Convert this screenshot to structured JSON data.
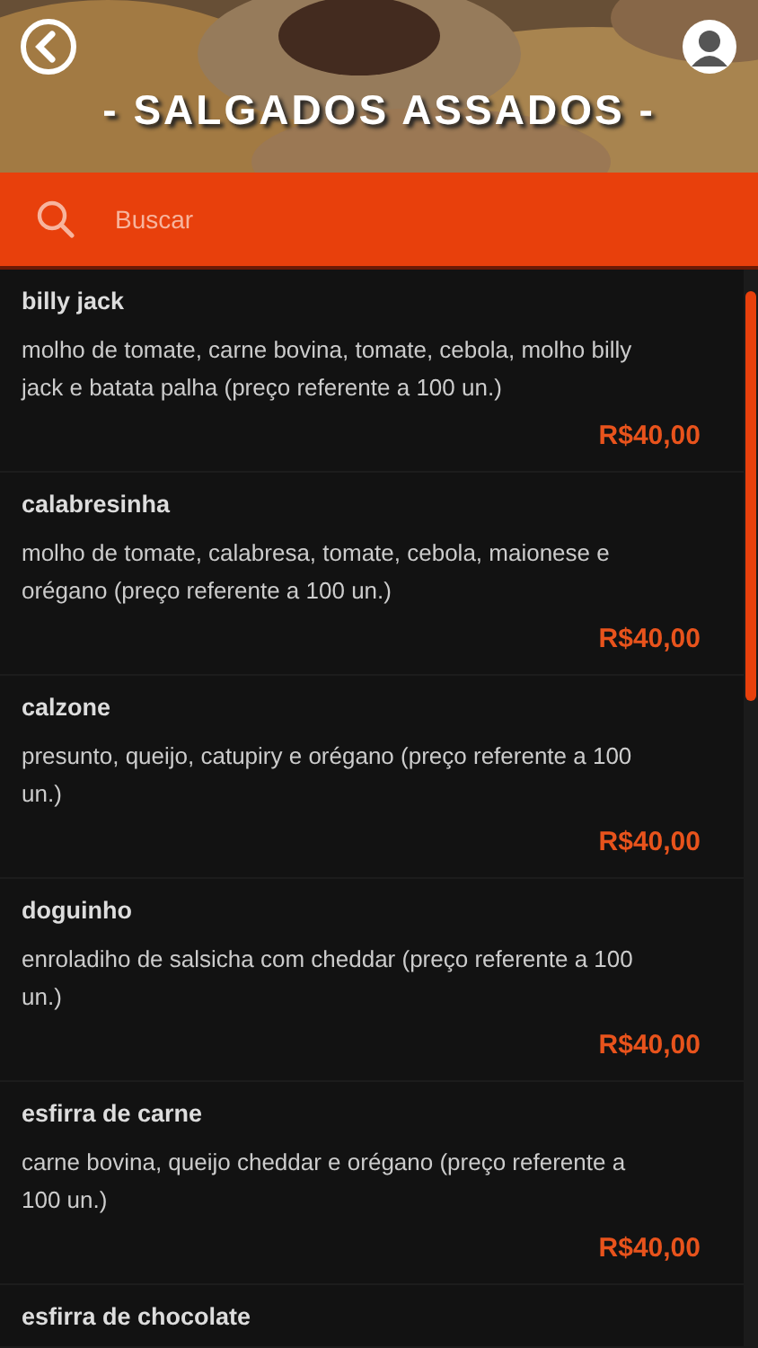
{
  "header": {
    "title": "- SALGADOS ASSADOS -"
  },
  "search": {
    "placeholder": "Buscar"
  },
  "items": [
    {
      "name": "billy jack",
      "description": "molho de tomate, carne bovina, tomate, cebola, molho billy jack e batata palha (preço referente a 100 un.)",
      "price": "R$40,00"
    },
    {
      "name": "calabresinha",
      "description": "molho de tomate, calabresa, tomate, cebola, maionese e orégano (preço referente a 100 un.)",
      "price": "R$40,00"
    },
    {
      "name": "calzone",
      "description": "presunto, queijo, catupiry e orégano (preço referente a 100 un.)",
      "price": "R$40,00"
    },
    {
      "name": "doguinho",
      "description": "enroladiho de salsicha com cheddar (preço referente a 100 un.)",
      "price": "R$40,00"
    },
    {
      "name": "esfirra de carne",
      "description": "carne bovina, queijo cheddar e orégano (preço referente a 100 un.)",
      "price": "R$40,00"
    },
    {
      "name": "esfirra de chocolate"
    }
  ]
}
